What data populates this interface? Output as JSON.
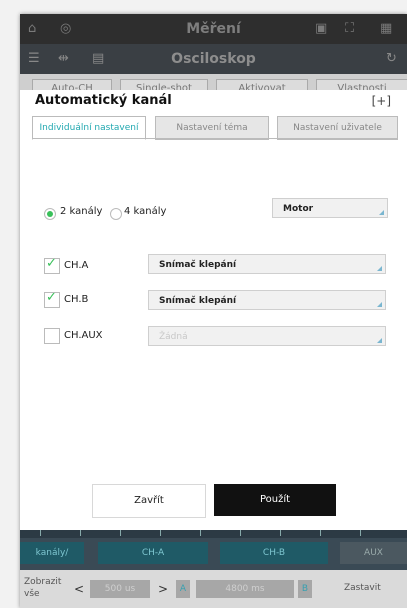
{
  "topbar": {
    "title": "Měření",
    "home_icon": "home-icon",
    "nav_icon": "target-icon"
  },
  "subbar": {
    "title": "Osciloskop"
  },
  "actions": [
    "Auto-CH",
    "Single-shot",
    "Aktivovat",
    "Vlastnosti"
  ],
  "dialog": {
    "title": "Automatický kanál",
    "tabs": [
      "Individuální nastavení",
      "Nastavení téma",
      "Nastavení uživatele"
    ],
    "radio_2": "2 kanály",
    "radio_4": "4 kanály",
    "profile_select": "Motor",
    "channels": [
      {
        "label": "CH.A",
        "checked": true,
        "value": "Snímač klepání",
        "enabled": true
      },
      {
        "label": "CH.B",
        "checked": true,
        "value": "Snímač klepání",
        "enabled": true
      },
      {
        "label": "CH.AUX",
        "checked": false,
        "value": "Žádná",
        "enabled": false
      }
    ],
    "close_button": "Zavřít",
    "apply_button": "Použít"
  },
  "bottom": {
    "channels_label": "kanály/",
    "ch_a": "CH-A",
    "ch_b": "CH-B",
    "aux": "AUX",
    "show": "Zobrazit vše",
    "value1": "500 us",
    "marker_a": "A",
    "value2": "4800 ms",
    "marker_b": "B",
    "stop": "Zastavit"
  }
}
